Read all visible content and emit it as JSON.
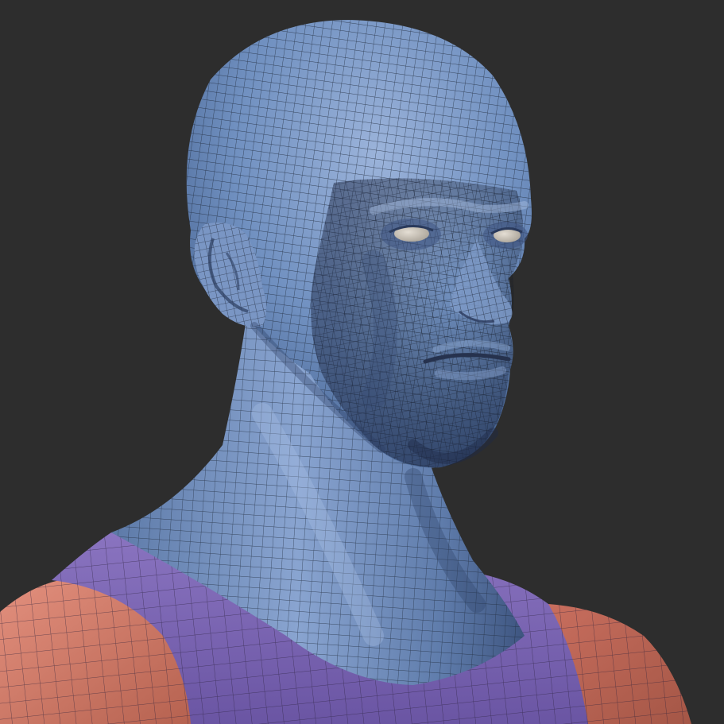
{
  "scene": {
    "subject": "head-and-shoulders-wireframe-sculpt",
    "colors": {
      "background": "#2d2d2d",
      "skin_polygroup": "#6d8ab8",
      "skin_highlight": "#93acd6",
      "skin_shadow": "#3f5680",
      "collar_polygroup": "#7c66b3",
      "collar_shadow": "#5a4890",
      "shoulder_polygroup": "#d57b6b",
      "shoulder_shadow": "#9e5447",
      "eyeball": "#cfc8bd",
      "wire": "#1d2636"
    }
  }
}
